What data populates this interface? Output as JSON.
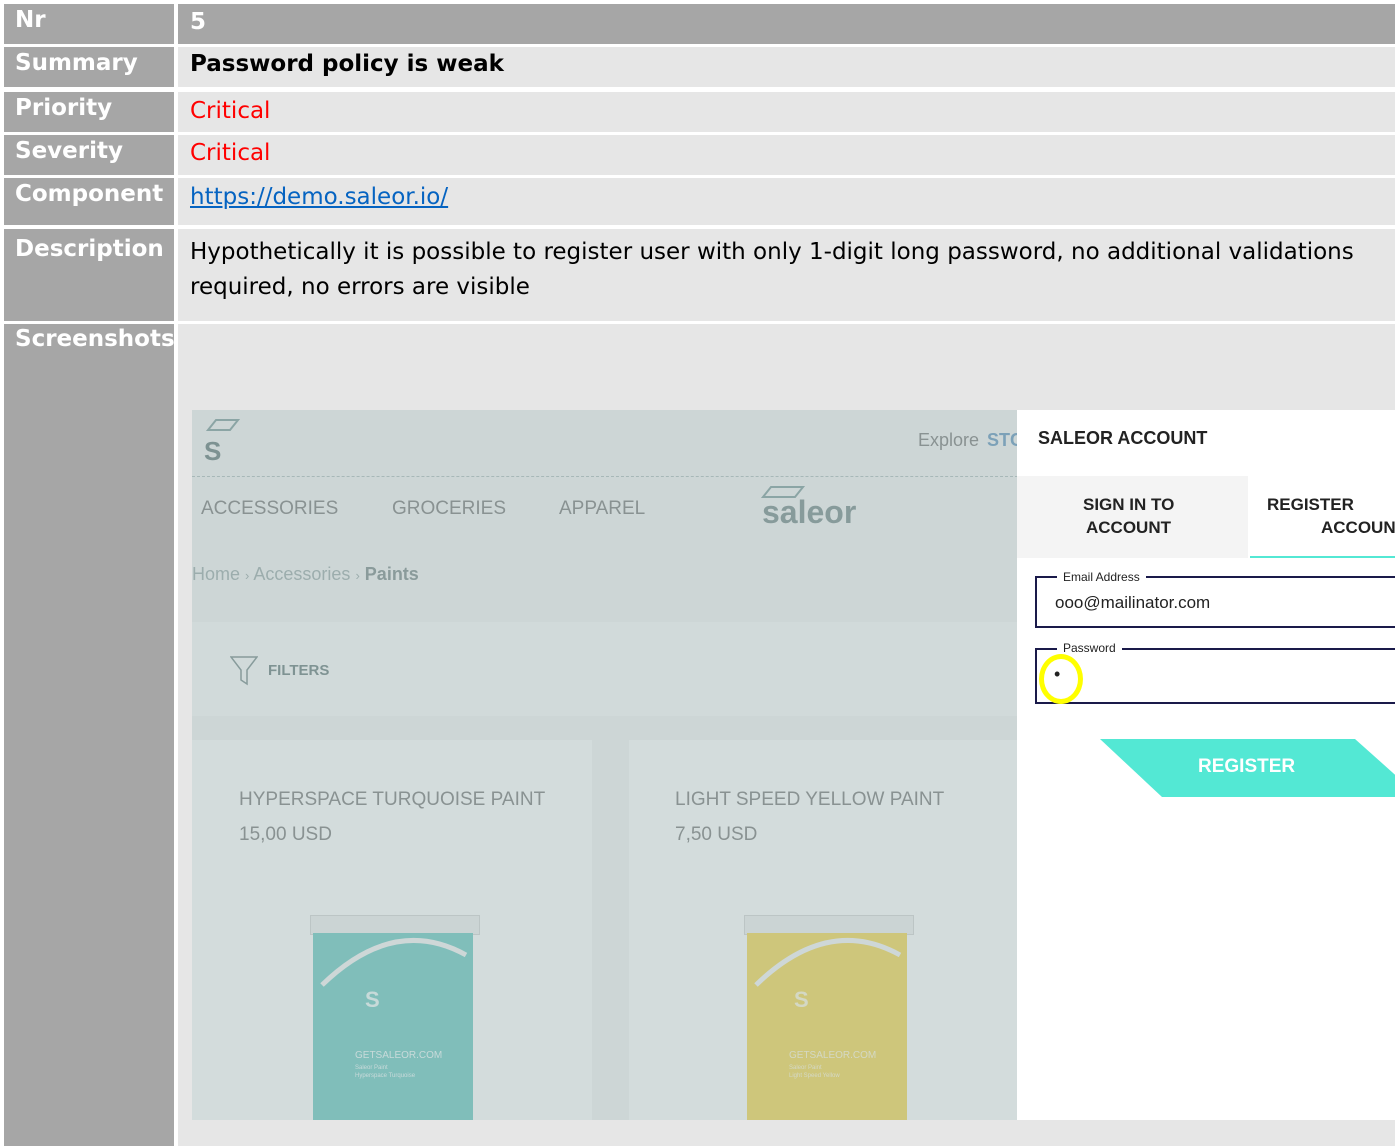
{
  "rows": {
    "nr": {
      "label": "Nr",
      "value": "5"
    },
    "summary": {
      "label": "Summary",
      "value": "Password policy is weak"
    },
    "priority": {
      "label": "Priority",
      "value": "Critical"
    },
    "severity": {
      "label": "Severity",
      "value": "Critical"
    },
    "component": {
      "label": "Component",
      "value": "https://demo.saleor.io/"
    },
    "description": {
      "label": "Description",
      "value": "Hypothetically it is possible to register user with only 1-digit long password, no additional validations required, no errors are visible"
    },
    "screenshots": {
      "label": "Screenshots"
    }
  },
  "screenshot": {
    "logo_letter": "S",
    "explore": "Explore",
    "explore_link": "STC",
    "nav": [
      "ACCESSORIES",
      "GROCERIES",
      "APPAREL"
    ],
    "brand": "saleor",
    "breadcrumb": [
      "Home",
      "Accessories",
      "Paints"
    ],
    "breadcrumb_sep": "›",
    "filters": "FILTERS",
    "products": [
      {
        "name": "HYPERSPACE TURQUOISE PAINT",
        "price": "15,00 USD",
        "brand": "GETSALEOR.COM",
        "sub1": "Saleor Paint",
        "sub2": "Hyperspace Turquoise"
      },
      {
        "name": "LIGHT SPEED YELLOW PAINT",
        "price": "7,50 USD",
        "brand": "GETSALEOR.COM",
        "sub1": "Saleor Paint",
        "sub2": "Light Speed Yellow"
      }
    ],
    "account": {
      "title": "SALEOR ACCOUNT",
      "tab_signin_1": "SIGN IN TO",
      "tab_signin_2": "ACCOUNT",
      "tab_register_1": "REGISTER",
      "tab_register_2": "ACCOUN",
      "email_label": "Email Address",
      "email_value": "ooo@mailinator.com",
      "password_label": "Password",
      "password_value": "•",
      "register_button": "REGISTER"
    },
    "colors": {
      "accent": "#53e8d4",
      "critical": "#ff0000",
      "link": "#0563c1",
      "highlight": "#ffff00"
    }
  }
}
